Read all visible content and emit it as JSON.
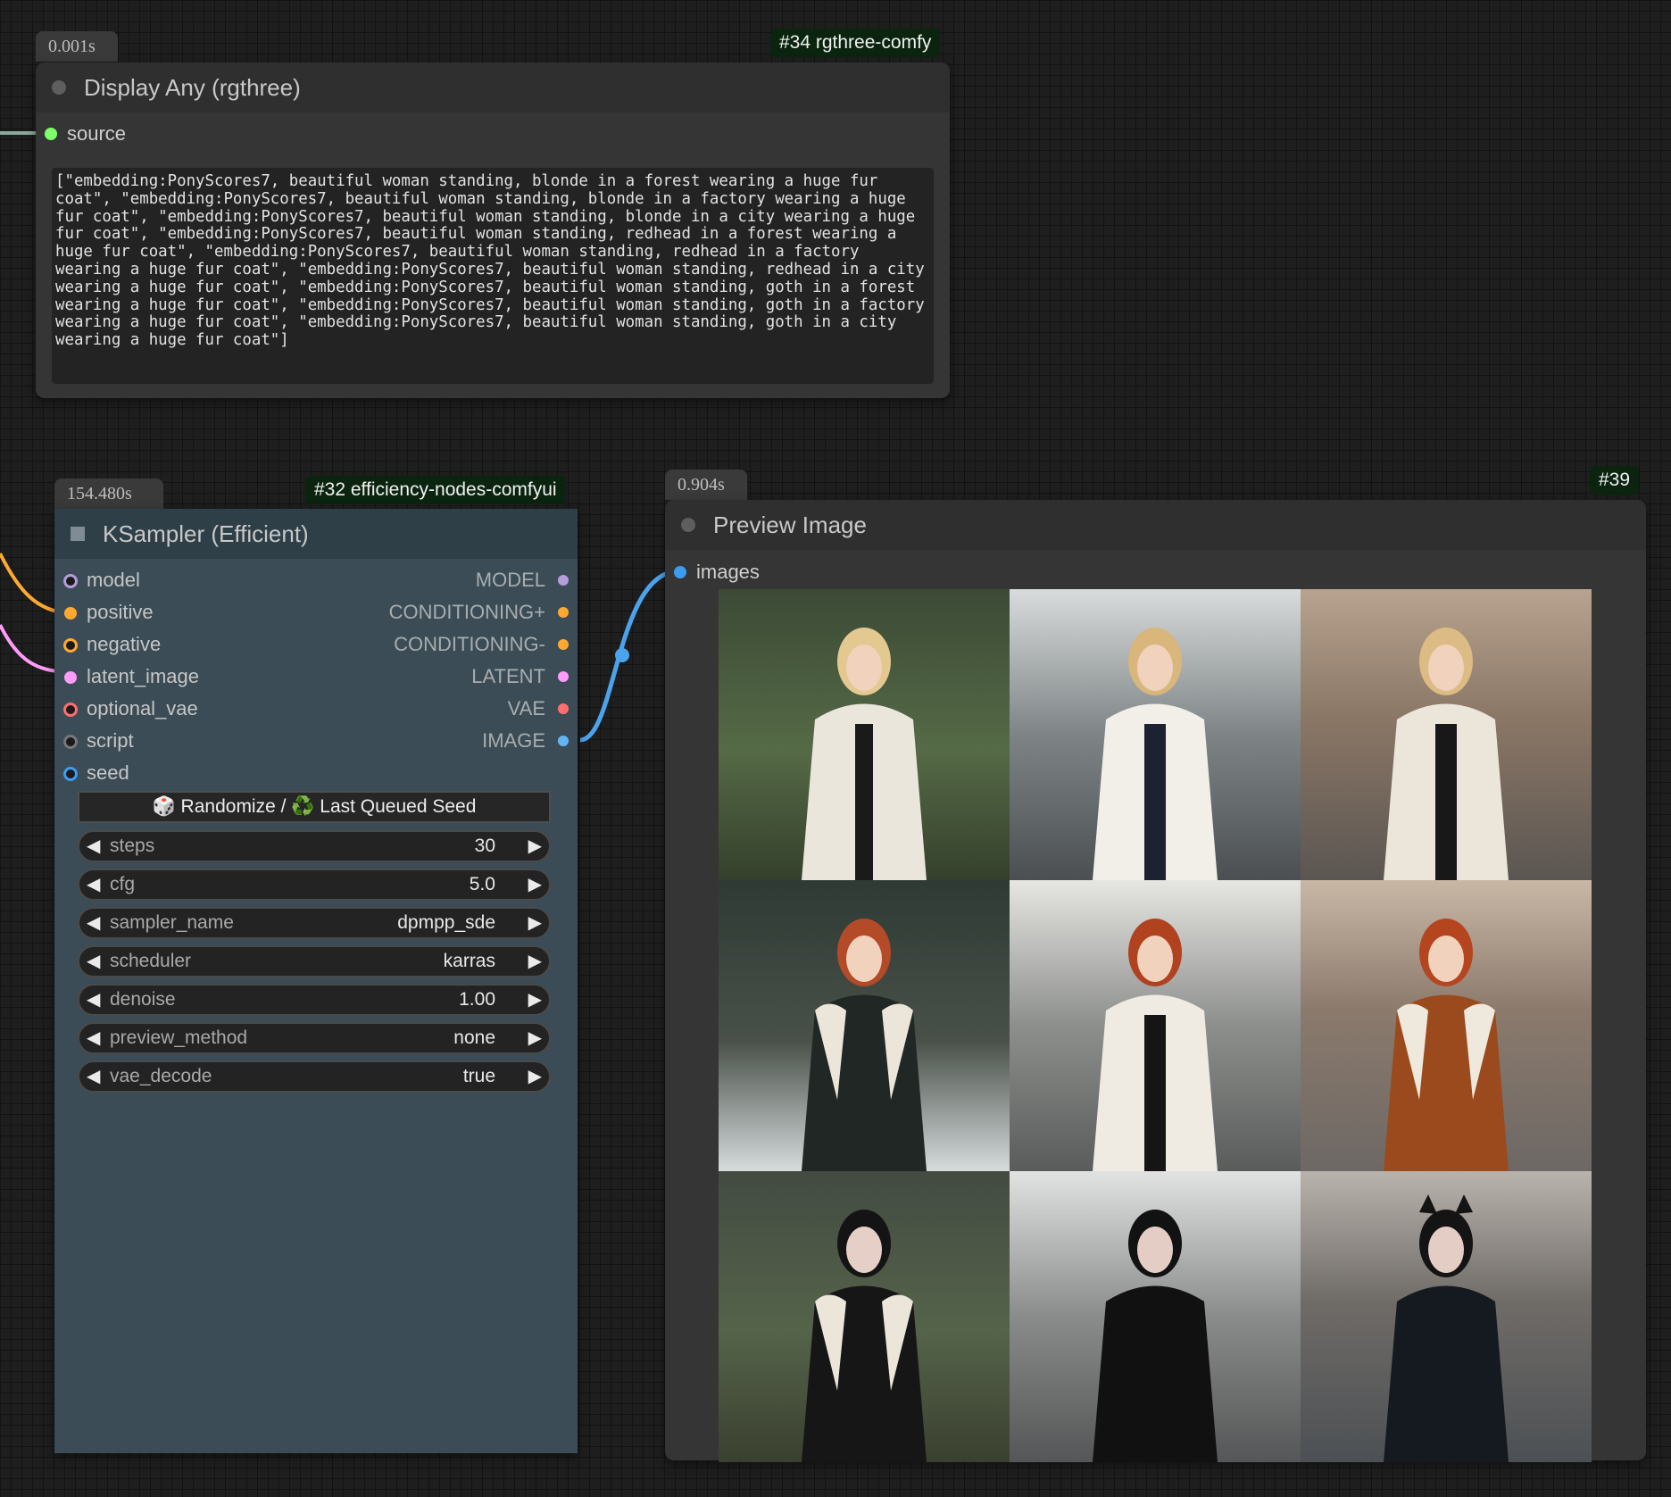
{
  "node_display_any": {
    "timing": "0.001s",
    "tag": "#34 rgthree-comfy",
    "title": "Display Any (rgthree)",
    "input_label": "source",
    "text": "[\"embedding:PonyScores7, beautiful woman standing, blonde in a forest wearing a huge fur coat\", \"embedding:PonyScores7, beautiful woman standing, blonde in a factory wearing a huge fur coat\", \"embedding:PonyScores7, beautiful woman standing, blonde in a city wearing a huge fur coat\", \"embedding:PonyScores7, beautiful woman standing, redhead in a forest wearing a huge fur coat\", \"embedding:PonyScores7, beautiful woman standing, redhead in a factory wearing a huge fur coat\", \"embedding:PonyScores7, beautiful woman standing, redhead in a city wearing a huge fur coat\", \"embedding:PonyScores7, beautiful woman standing, goth in a forest wearing a huge fur coat\", \"embedding:PonyScores7, beautiful woman standing, goth in a factory wearing a huge fur coat\", \"embedding:PonyScores7, beautiful woman standing, goth in a city wearing a huge fur coat\"]"
  },
  "node_ksampler": {
    "timing": "154.480s",
    "tag": "#32 efficiency-nodes-comfyui",
    "title": "KSampler (Efficient)",
    "inputs": [
      "model",
      "positive",
      "negative",
      "latent_image",
      "optional_vae",
      "script",
      "seed"
    ],
    "outputs": [
      "MODEL",
      "CONDITIONING+",
      "CONDITIONING-",
      "LATENT",
      "VAE",
      "IMAGE"
    ],
    "seed_button": "🎲 Randomize / ♻️ Last Queued Seed",
    "widgets": [
      {
        "label": "steps",
        "value": "30"
      },
      {
        "label": "cfg",
        "value": "5.0"
      },
      {
        "label": "sampler_name",
        "value": "dpmpp_sde"
      },
      {
        "label": "scheduler",
        "value": "karras"
      },
      {
        "label": "denoise",
        "value": "1.00"
      },
      {
        "label": "preview_method",
        "value": "none"
      },
      {
        "label": "vae_decode",
        "value": "true"
      }
    ]
  },
  "node_preview": {
    "timing": "0.904s",
    "tag": "#39",
    "title": "Preview Image",
    "input_label": "images"
  },
  "colors": {
    "model": "#b39ddb",
    "conditioning": "#ffa931",
    "latent": "#ff9cf9",
    "vae": "#ff6e6e",
    "script": "#888888",
    "seed": "#3c9cf0",
    "image": "#64b5f6",
    "source": "#7cff6b"
  }
}
